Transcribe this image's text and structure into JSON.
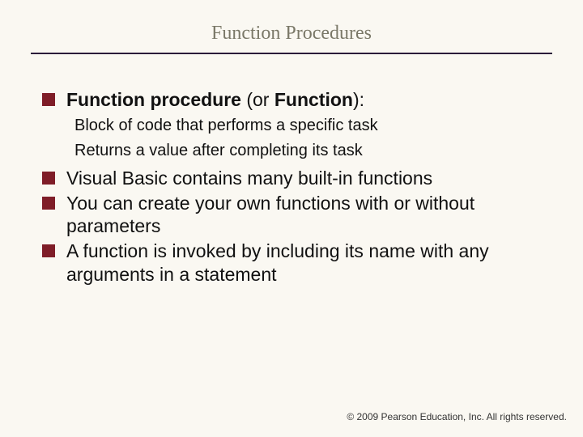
{
  "title": "Function Procedures",
  "heading_bold1": "Function procedure",
  "heading_mid": " (or ",
  "heading_bold2": "Function",
  "heading_end": "):",
  "sub1": "Block of code that performs a specific task",
  "sub2": "Returns a value after completing its task",
  "p1": "Visual Basic contains many built-in functions",
  "p2": "You can create your own functions with or without parameters",
  "p3": "A function is invoked by including its name with any arguments in a statement",
  "footer": "© 2009 Pearson Education, Inc.  All rights reserved."
}
